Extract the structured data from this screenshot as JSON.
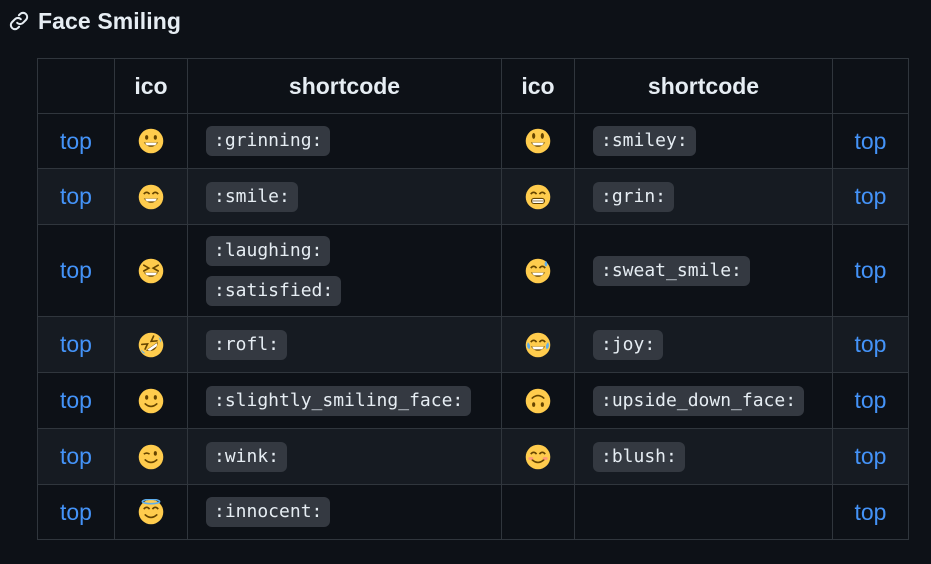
{
  "heading": {
    "title": "Face Smiling",
    "icon": "link-icon"
  },
  "table": {
    "headers": [
      "",
      "ico",
      "shortcode",
      "ico",
      "shortcode",
      ""
    ],
    "top_label": "top",
    "rows": [
      {
        "left_icon": "grinning-face",
        "left_codes": [
          ":grinning:"
        ],
        "right_icon": "smiley-face",
        "right_codes": [
          ":smiley:"
        ]
      },
      {
        "left_icon": "smile-face",
        "left_codes": [
          ":smile:"
        ],
        "right_icon": "grin-face",
        "right_codes": [
          ":grin:"
        ]
      },
      {
        "left_icon": "laughing-face",
        "left_codes": [
          ":laughing:",
          ":satisfied:"
        ],
        "right_icon": "sweat-smile-face",
        "right_codes": [
          ":sweat_smile:"
        ]
      },
      {
        "left_icon": "rofl-face",
        "left_codes": [
          ":rofl:"
        ],
        "right_icon": "joy-face",
        "right_codes": [
          ":joy:"
        ]
      },
      {
        "left_icon": "slightly-smiling-face",
        "left_codes": [
          ":slightly_smiling_face:"
        ],
        "right_icon": "upside-down-face",
        "right_codes": [
          ":upside_down_face:"
        ]
      },
      {
        "left_icon": "wink-face",
        "left_codes": [
          ":wink:"
        ],
        "right_icon": "blush-face",
        "right_codes": [
          ":blush:"
        ]
      },
      {
        "left_icon": "innocent-face",
        "left_codes": [
          ":innocent:"
        ],
        "right_icon": "",
        "right_codes": []
      }
    ]
  },
  "colors": {
    "background": "#0d1117",
    "row_alt": "#161b22",
    "border": "#30363d",
    "link": "#4493f8",
    "code_bg": "#343941",
    "text": "#e6edf3"
  }
}
